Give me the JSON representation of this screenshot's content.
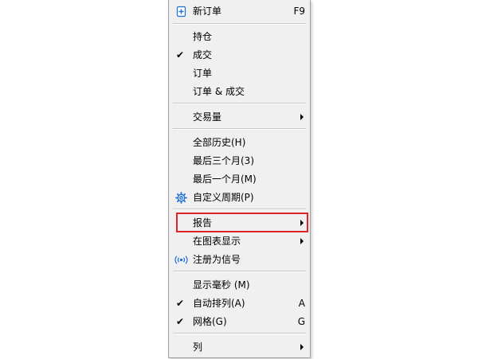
{
  "menu": {
    "items": [
      {
        "label": "新订单",
        "shortcut": "F9",
        "icon": "new-document-icon"
      },
      {
        "label": "持仓"
      },
      {
        "label": "成交",
        "checked": true
      },
      {
        "label": "订单"
      },
      {
        "label": "订单 & 成交"
      },
      {
        "label": "交易量",
        "submenu": true
      },
      {
        "label": "全部历史(H)"
      },
      {
        "label": "最后三个月(3)"
      },
      {
        "label": "最后一个月(M)"
      },
      {
        "label": "自定义周期(P)",
        "icon": "gear-icon"
      },
      {
        "label": "报告",
        "submenu": true,
        "highlighted": true
      },
      {
        "label": "在图表显示",
        "submenu": true
      },
      {
        "label": "注册为信号",
        "icon": "signal-broadcast-icon"
      },
      {
        "label": "显示毫秒 (M)"
      },
      {
        "label": "自动排列(A)",
        "shortcut": "A",
        "checked": true
      },
      {
        "label": "网格(G)",
        "shortcut": "G",
        "checked": true
      },
      {
        "label": "列",
        "submenu": true
      }
    ],
    "check_glyph": "✔",
    "colors": {
      "background": "#f0f0f0",
      "border": "#a0a0a0",
      "highlight_box": "#e0242a",
      "icon_blue": "#1e6fd9"
    }
  }
}
